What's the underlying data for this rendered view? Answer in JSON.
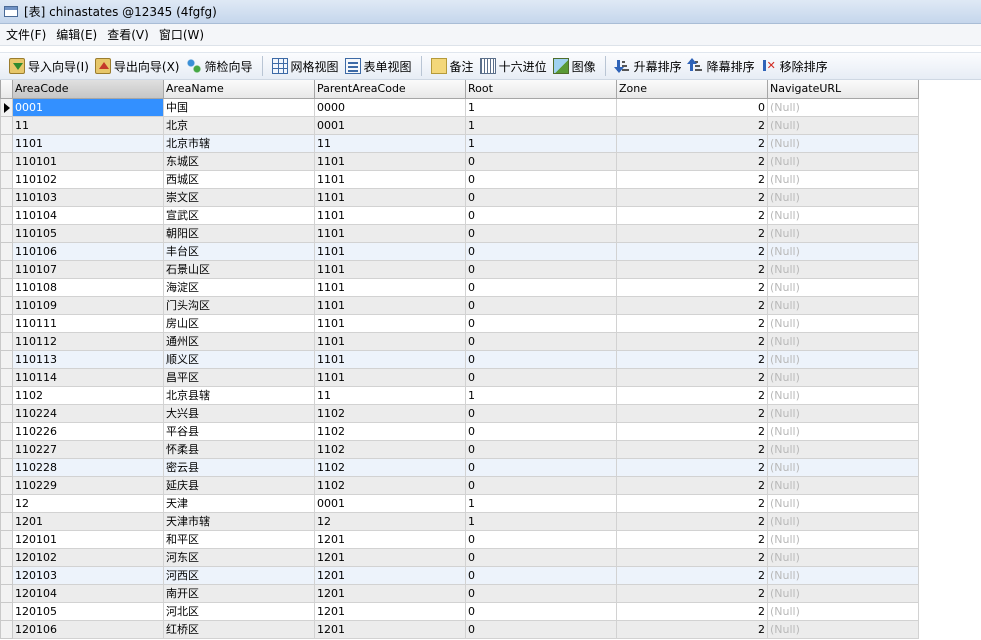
{
  "window": {
    "title": "[表] chinastates @12345 (4fgfg)"
  },
  "menu": [
    "文件(F)",
    "编辑(E)",
    "查看(V)",
    "窗口(W)"
  ],
  "toolbar": {
    "import": "导入向导(I)",
    "export": "导出向导(X)",
    "filter": "筛检向导",
    "grid_view": "网格视图",
    "form_view": "表单视图",
    "memo": "备注",
    "hex": "十六进位",
    "image": "图像",
    "sort_asc": "升幕排序",
    "sort_desc": "降幕排序",
    "remove_sort": "移除排序"
  },
  "grid": {
    "columns": [
      "AreaCode",
      "AreaName",
      "ParentAreaCode",
      "Root",
      "Zone",
      "NavigateURL"
    ],
    "rows": [
      [
        "0001",
        "中国",
        "0000",
        "1",
        "0",
        "(Null)"
      ],
      [
        "11",
        "北京",
        "0001",
        "1",
        "2",
        "(Null)"
      ],
      [
        "1101",
        "北京市辖",
        "11",
        "1",
        "2",
        "(Null)"
      ],
      [
        "110101",
        "东城区",
        "1101",
        "0",
        "2",
        "(Null)"
      ],
      [
        "110102",
        "西城区",
        "1101",
        "0",
        "2",
        "(Null)"
      ],
      [
        "110103",
        "崇文区",
        "1101",
        "0",
        "2",
        "(Null)"
      ],
      [
        "110104",
        "宣武区",
        "1101",
        "0",
        "2",
        "(Null)"
      ],
      [
        "110105",
        "朝阳区",
        "1101",
        "0",
        "2",
        "(Null)"
      ],
      [
        "110106",
        "丰台区",
        "1101",
        "0",
        "2",
        "(Null)"
      ],
      [
        "110107",
        "石景山区",
        "1101",
        "0",
        "2",
        "(Null)"
      ],
      [
        "110108",
        "海淀区",
        "1101",
        "0",
        "2",
        "(Null)"
      ],
      [
        "110109",
        "门头沟区",
        "1101",
        "0",
        "2",
        "(Null)"
      ],
      [
        "110111",
        "房山区",
        "1101",
        "0",
        "2",
        "(Null)"
      ],
      [
        "110112",
        "通州区",
        "1101",
        "0",
        "2",
        "(Null)"
      ],
      [
        "110113",
        "顺义区",
        "1101",
        "0",
        "2",
        "(Null)"
      ],
      [
        "110114",
        "昌平区",
        "1101",
        "0",
        "2",
        "(Null)"
      ],
      [
        "1102",
        "北京县辖",
        "11",
        "1",
        "2",
        "(Null)"
      ],
      [
        "110224",
        "大兴县",
        "1102",
        "0",
        "2",
        "(Null)"
      ],
      [
        "110226",
        "平谷县",
        "1102",
        "0",
        "2",
        "(Null)"
      ],
      [
        "110227",
        "怀柔县",
        "1102",
        "0",
        "2",
        "(Null)"
      ],
      [
        "110228",
        "密云县",
        "1102",
        "0",
        "2",
        "(Null)"
      ],
      [
        "110229",
        "延庆县",
        "1102",
        "0",
        "2",
        "(Null)"
      ],
      [
        "12",
        "天津",
        "0001",
        "1",
        "2",
        "(Null)"
      ],
      [
        "1201",
        "天津市辖",
        "12",
        "1",
        "2",
        "(Null)"
      ],
      [
        "120101",
        "和平区",
        "1201",
        "0",
        "2",
        "(Null)"
      ],
      [
        "120102",
        "河东区",
        "1201",
        "0",
        "2",
        "(Null)"
      ],
      [
        "120103",
        "河西区",
        "1201",
        "0",
        "2",
        "(Null)"
      ],
      [
        "120104",
        "南开区",
        "1201",
        "0",
        "2",
        "(Null)"
      ],
      [
        "120105",
        "河北区",
        "1201",
        "0",
        "2",
        "(Null)"
      ],
      [
        "120106",
        "红桥区",
        "1201",
        "0",
        "2",
        "(Null)"
      ]
    ]
  }
}
